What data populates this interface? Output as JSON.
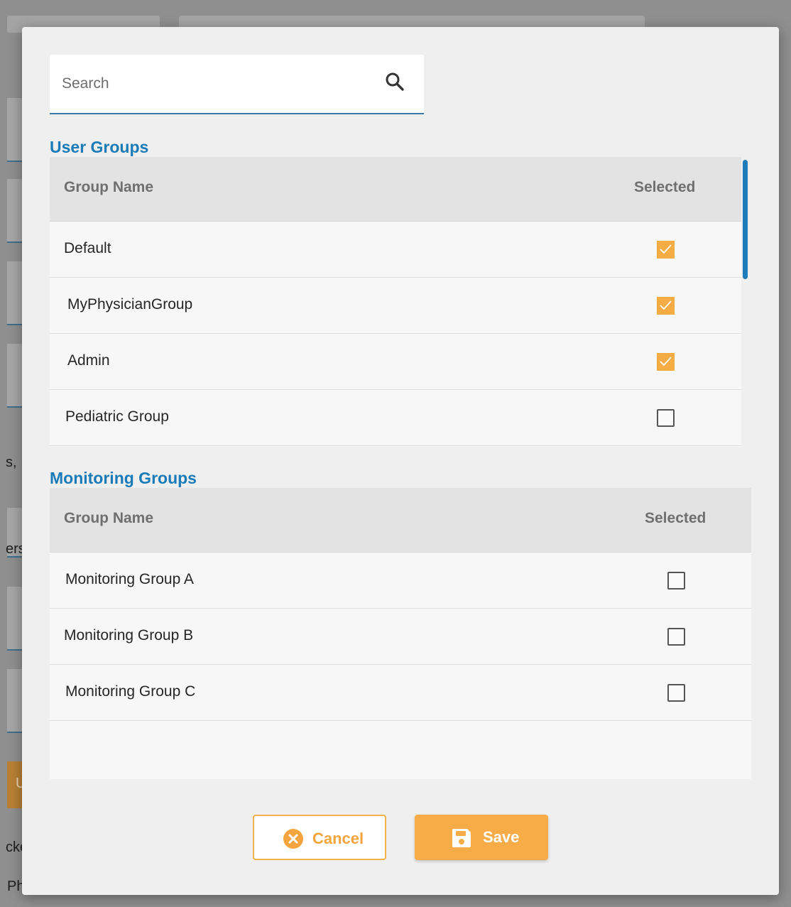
{
  "background": {
    "snippets": [
      "s, I",
      "ers",
      "cke",
      "Ph"
    ],
    "button_letter": "U"
  },
  "search": {
    "placeholder": "Search",
    "value": ""
  },
  "user_groups": {
    "title": "User Groups",
    "columns": {
      "name": "Group Name",
      "selected": "Selected"
    },
    "rows": [
      {
        "name": "Default",
        "selected": true
      },
      {
        "name": "MyPhysicianGroup",
        "selected": true
      },
      {
        "name": "Admin",
        "selected": true
      },
      {
        "name": "Pediatric Group",
        "selected": false
      }
    ]
  },
  "monitoring_groups": {
    "title": "Monitoring Groups",
    "columns": {
      "name": "Group Name",
      "selected": "Selected"
    },
    "rows": [
      {
        "name": "Monitoring Group A",
        "selected": false
      },
      {
        "name": "Monitoring Group B",
        "selected": false
      },
      {
        "name": "Monitoring Group C",
        "selected": false
      }
    ]
  },
  "actions": {
    "cancel_label": "Cancel",
    "save_label": "Save"
  },
  "colors": {
    "accent": "#f8ac48",
    "section_title": "#1a7bb8",
    "scrollbar": "#1d7cbb"
  }
}
